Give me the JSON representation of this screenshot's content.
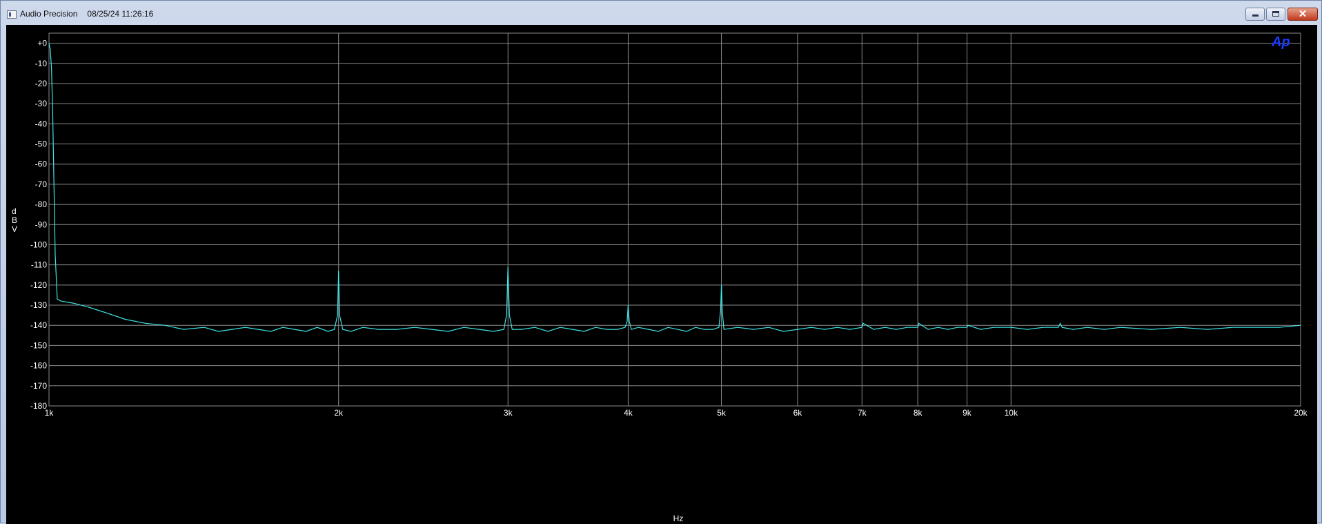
{
  "window": {
    "title": "Audio Precision",
    "timestamp": "08/25/24 11:26:16",
    "minimize_icon": "minimize-icon",
    "maximize_icon": "maximize-icon",
    "close_icon": "close-icon",
    "close_glyph": "✕"
  },
  "logo": {
    "text": "Ap",
    "color": "#1c3cff"
  },
  "colors": {
    "background": "#000000",
    "grid": "#8c8c8c",
    "trace": "#3fe6e6",
    "text": "#ffffff"
  },
  "chart_data": {
    "type": "line",
    "xlabel": "Hz",
    "ylabel": "dBV",
    "ylabel_letters": [
      "d",
      "B",
      "V"
    ],
    "x_scale": "log",
    "xlim": [
      1000,
      20000
    ],
    "ylim": [
      -180,
      5
    ],
    "grid": true,
    "x_ticks": [
      {
        "value": 1000,
        "label": "1k"
      },
      {
        "value": 2000,
        "label": "2k"
      },
      {
        "value": 3000,
        "label": "3k"
      },
      {
        "value": 4000,
        "label": "4k"
      },
      {
        "value": 5000,
        "label": "5k"
      },
      {
        "value": 6000,
        "label": "6k"
      },
      {
        "value": 7000,
        "label": "7k"
      },
      {
        "value": 8000,
        "label": "8k"
      },
      {
        "value": 9000,
        "label": "9k"
      },
      {
        "value": 10000,
        "label": "10k"
      },
      {
        "value": 20000,
        "label": "20k"
      }
    ],
    "y_ticks": [
      {
        "value": 0,
        "label": "+0"
      },
      {
        "value": -10,
        "label": "-10"
      },
      {
        "value": -20,
        "label": "-20"
      },
      {
        "value": -30,
        "label": "-30"
      },
      {
        "value": -40,
        "label": "-40"
      },
      {
        "value": -50,
        "label": "-50"
      },
      {
        "value": -60,
        "label": "-60"
      },
      {
        "value": -70,
        "label": "-70"
      },
      {
        "value": -80,
        "label": "-80"
      },
      {
        "value": -90,
        "label": "-90"
      },
      {
        "value": -100,
        "label": "-100"
      },
      {
        "value": -110,
        "label": "-110"
      },
      {
        "value": -120,
        "label": "-120"
      },
      {
        "value": -130,
        "label": "-130"
      },
      {
        "value": -140,
        "label": "-140"
      },
      {
        "value": -150,
        "label": "-150"
      },
      {
        "value": -160,
        "label": "-160"
      },
      {
        "value": -170,
        "label": "-170"
      },
      {
        "value": -180,
        "label": "-180"
      }
    ],
    "series": [
      {
        "x": [
          1000,
          1003,
          1006,
          1009,
          1012,
          1015,
          1020,
          1030,
          1060,
          1100,
          1150,
          1200,
          1260,
          1320,
          1380,
          1450,
          1500,
          1550,
          1600,
          1650,
          1700,
          1750,
          1800,
          1850,
          1900,
          1950,
          1980,
          1995,
          2000,
          2005,
          2020,
          2060,
          2120,
          2200,
          2300,
          2400,
          2500,
          2600,
          2700,
          2800,
          2900,
          2970,
          2990,
          3000,
          3010,
          3030,
          3100,
          3200,
          3300,
          3400,
          3500,
          3600,
          3700,
          3800,
          3900,
          3970,
          3990,
          4000,
          4010,
          4030,
          4100,
          4200,
          4300,
          4400,
          4500,
          4600,
          4700,
          4800,
          4900,
          4970,
          4990,
          5000,
          5010,
          5030,
          5200,
          5400,
          5600,
          5800,
          6000,
          6200,
          6400,
          6600,
          6800,
          7000,
          7020,
          7200,
          7400,
          7600,
          7800,
          8000,
          8020,
          8200,
          8400,
          8600,
          8800,
          9000,
          9020,
          9300,
          9600,
          10000,
          10400,
          10800,
          11200,
          11250,
          11300,
          11600,
          12000,
          12500,
          13000,
          14000,
          15000,
          16000,
          17000,
          18000,
          19000,
          20000
        ],
        "y": [
          0,
          -3,
          -12,
          -35,
          -70,
          -105,
          -127,
          -128,
          -129,
          -131,
          -134,
          -137,
          -139,
          -140,
          -142,
          -141,
          -143,
          -142,
          -141,
          -142,
          -143,
          -141,
          -142,
          -143,
          -141,
          -143,
          -142,
          -135,
          -113,
          -135,
          -142,
          -143,
          -141,
          -142,
          -142,
          -141,
          -142,
          -143,
          -141,
          -142,
          -143,
          -142,
          -135,
          -111,
          -135,
          -142,
          -142,
          -141,
          -143,
          -141,
          -142,
          -143,
          -141,
          -142,
          -142,
          -141,
          -138,
          -130,
          -138,
          -142,
          -141,
          -142,
          -143,
          -141,
          -142,
          -143,
          -141,
          -142,
          -142,
          -141,
          -133,
          -120,
          -133,
          -142,
          -141,
          -142,
          -141,
          -143,
          -142,
          -141,
          -142,
          -141,
          -142,
          -141,
          -139,
          -142,
          -141,
          -142,
          -141,
          -141,
          -139,
          -142,
          -141,
          -142,
          -141,
          -141,
          -140,
          -142,
          -141,
          -141,
          -142,
          -141,
          -141,
          -139,
          -141,
          -142,
          -141,
          -142,
          -141,
          -142,
          -141,
          -142,
          -141,
          -141,
          -141,
          -140
        ]
      }
    ]
  }
}
